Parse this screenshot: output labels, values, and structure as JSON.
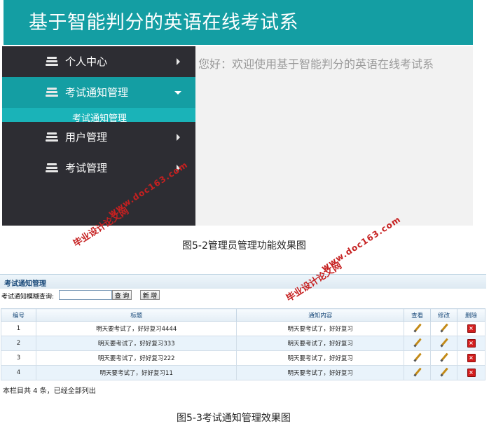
{
  "figure1": {
    "header_title": "基于智能判分的英语在线考试系",
    "sidebar": {
      "items": [
        {
          "label": "个人中心",
          "icon": "list-icon",
          "arrow": "right"
        },
        {
          "label": "考试通知管理",
          "icon": "list-icon",
          "arrow": "down",
          "active": true
        },
        {
          "label": "用户管理",
          "icon": "list-icon",
          "arrow": "right"
        },
        {
          "label": "考试管理",
          "icon": "list-icon",
          "arrow": "right"
        }
      ],
      "submenu_label": "考试通知管理"
    },
    "welcome_text": "您好：欢迎使用基于智能判分的英语在线考试系",
    "caption": "图5-2管理员管理功能效果图"
  },
  "figure2": {
    "panel_title": "考试通知管理",
    "search_label": "考试通知模糊查询:",
    "search_value": "",
    "search_button": "查 询",
    "new_button": "新 增",
    "columns": [
      "编号",
      "标题",
      "通知内容",
      "查看",
      "修改",
      "删除"
    ],
    "rows": [
      {
        "id": "1",
        "title": "明天要考试了，好好复习4444",
        "content": "明天要考试了，好好复习"
      },
      {
        "id": "2",
        "title": "明天要考试了，好好复习333",
        "content": "明天要考试了，好好复习"
      },
      {
        "id": "3",
        "title": "明天要考试了，好好复习222",
        "content": "明天要考试了，好好复习"
      },
      {
        "id": "4",
        "title": "明天要考试了，好好复习11",
        "content": "明天要考试了，好好复习"
      }
    ],
    "footer_note": "本栏目共 4 条，已经全部列出",
    "caption": "图5-3考试通知管理效果图"
  },
  "watermark": {
    "line1": "毕业设计论文网",
    "line2": "www.doc163.com",
    "color": "#c62020"
  },
  "colors": {
    "header": "#149ea3",
    "sidebar": "#2d2d33",
    "active": "#149ea3"
  }
}
